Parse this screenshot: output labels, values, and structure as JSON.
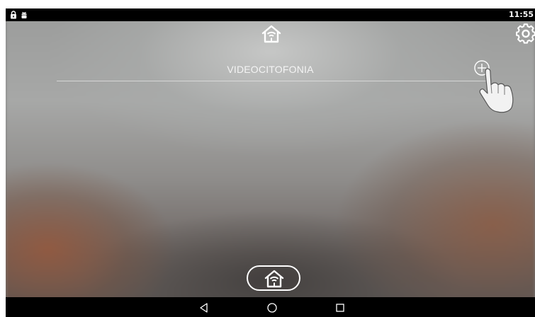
{
  "status_bar": {
    "time": "11:55",
    "icons": [
      "lock-icon",
      "android-icon"
    ]
  },
  "header": {
    "icon": "smart-home-icon",
    "settings_icon": "gear-icon"
  },
  "section": {
    "title": "VIDEOCITOFONIA",
    "add_icon": "plus-circle-icon"
  },
  "overlay": {
    "icon": "pointing-hand-icon"
  },
  "bottom": {
    "home_button_icon": "smart-home-icon"
  },
  "nav_bar": {
    "icons": [
      "back-triangle-icon",
      "home-circle-icon",
      "recents-square-icon"
    ]
  },
  "colors": {
    "status_bar_bg": "#000000",
    "text": "#f4f4f4",
    "icon": "#ffffff"
  }
}
